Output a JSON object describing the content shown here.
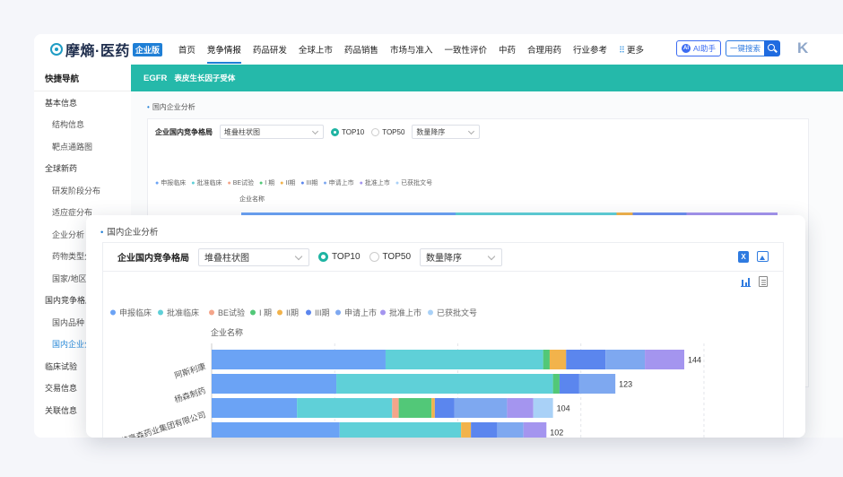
{
  "header": {
    "logo_text": "摩熵·医药",
    "logo_badge": "企业版",
    "nav": [
      "首页",
      "竞争情报",
      "药品研发",
      "全球上市",
      "药品销售",
      "市场与准入",
      "一致性评价",
      "中药",
      "合理用药",
      "行业参考"
    ],
    "nav_active_index": 1,
    "more_label": "更多",
    "ai_label": "AI助手",
    "search_label": "一键搜索"
  },
  "sidebar": {
    "title": "快捷导航",
    "items": [
      {
        "label": "基本信息",
        "level": 1
      },
      {
        "label": "结构信息",
        "level": 2
      },
      {
        "label": "靶点通路图",
        "level": 2
      },
      {
        "label": "全球新药",
        "level": 1
      },
      {
        "label": "研发阶段分布",
        "level": 2
      },
      {
        "label": "适应症分布",
        "level": 2
      },
      {
        "label": "企业分析",
        "level": 2
      },
      {
        "label": "药物类型分布",
        "level": 2
      },
      {
        "label": "国家/地区",
        "level": 2
      },
      {
        "label": "国内竞争格局",
        "level": 1
      },
      {
        "label": "国内品种",
        "level": 2
      },
      {
        "label": "国内企业分析",
        "level": 2,
        "active": true
      },
      {
        "label": "临床试验",
        "level": 1
      },
      {
        "label": "交易信息",
        "level": 1
      },
      {
        "label": "关联信息",
        "level": 1
      }
    ]
  },
  "target_bar": {
    "code": "EGFR",
    "name": "表皮生长因子受体"
  },
  "section": {
    "title": "国内企业分析",
    "controls": {
      "label": "企业国内竞争格局",
      "chart_type": "堆叠柱状图",
      "radio_options": [
        "TOP10",
        "TOP50"
      ],
      "radio_selected": "TOP10",
      "sort": "数量降序"
    }
  },
  "icons": {
    "export_excel": "excel-icon",
    "export_image": "image-icon",
    "view_bar": "bar-chart-icon",
    "view_table": "document-icon"
  },
  "colors": {
    "accent_teal": "#25b9aa",
    "brand_blue": "#1f7fd6"
  },
  "chart_data": {
    "type": "bar",
    "orientation": "horizontal",
    "stacked": true,
    "ylabel": "企业名称",
    "categories": [
      "阿斯利康",
      "杨森制药",
      "江苏豪森药业集团有限公司",
      ""
    ],
    "totals": [
      144,
      123,
      104,
      102
    ],
    "series": [
      {
        "name": "申报临床",
        "color": "#6ba3f5",
        "values": [
          53,
          38,
          26,
          39
        ]
      },
      {
        "name": "批准临床",
        "color": "#5fd0d8",
        "values": [
          48,
          66,
          29,
          37
        ]
      },
      {
        "name": "BE试验",
        "color": "#f4a58a",
        "values": [
          0,
          0,
          2,
          0
        ]
      },
      {
        "name": "I 期",
        "color": "#52c878",
        "values": [
          2,
          2,
          10,
          0
        ]
      },
      {
        "name": "II期",
        "color": "#f2b34b",
        "values": [
          5,
          0,
          1,
          3
        ]
      },
      {
        "name": "III期",
        "color": "#5b86ee",
        "values": [
          12,
          6,
          6,
          8
        ]
      },
      {
        "name": "申请上市",
        "color": "#7ea8f0",
        "values": [
          12,
          11,
          16,
          8
        ]
      },
      {
        "name": "批准上市",
        "color": "#a495ef",
        "values": [
          12,
          0,
          8,
          7
        ]
      },
      {
        "name": "已获批文号",
        "color": "#a9d1f7",
        "values": [
          0,
          0,
          6,
          0
        ]
      }
    ]
  }
}
